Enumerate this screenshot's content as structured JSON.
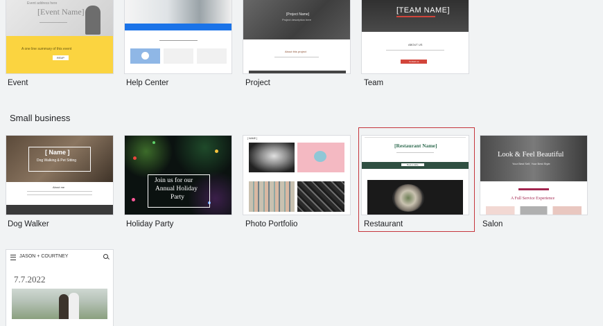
{
  "row1": {
    "event": {
      "label": "Event",
      "thumb_title": "[Event Name]",
      "thumb_sub": "Event address here",
      "thumb_tag": "A one line summary of this event",
      "thumb_btn": "RSVP"
    },
    "help_center": {
      "label": "Help Center"
    },
    "project": {
      "label": "Project",
      "thumb_title": "[Project Name]",
      "thumb_sub": "Project description here",
      "thumb_body": "About this project"
    },
    "team": {
      "label": "Team",
      "thumb_title": "[TEAM NAME]",
      "thumb_body": "ABOUT US",
      "thumb_btn": "Contact us"
    }
  },
  "small_business": {
    "heading": "Small business",
    "dog_walker": {
      "label": "Dog Walker",
      "thumb_title": "[ Name ]",
      "thumb_sub": "Dog Walking & Pet Sitting",
      "thumb_body": "About me"
    },
    "holiday_party": {
      "label": "Holiday Party",
      "thumb_title_1": "Join us for our",
      "thumb_title_2": "Annual Holiday",
      "thumb_title_3": "Party"
    },
    "photo_portfolio": {
      "label": "Photo Portfolio",
      "thumb_brand": "[ NAME ]"
    },
    "restaurant": {
      "label": "Restaurant",
      "thumb_title": "[Restaurant Name]",
      "thumb_btn": "Book a table"
    },
    "salon": {
      "label": "Salon",
      "thumb_title": "Look & Feel Beautiful",
      "thumb_sub": "Your Best Self, Your Best Style",
      "thumb_body": "A Full Service Experience"
    }
  },
  "row3": {
    "wedding": {
      "names": "JASON + COURTNEY",
      "date": "7.7.2022"
    }
  },
  "colors": {
    "selection": "#c5343b",
    "event_yellow": "#fbd440",
    "help_blue": "#1a73e8",
    "restaurant_green": "#2f4f41",
    "salon_pink": "#a3264f"
  }
}
